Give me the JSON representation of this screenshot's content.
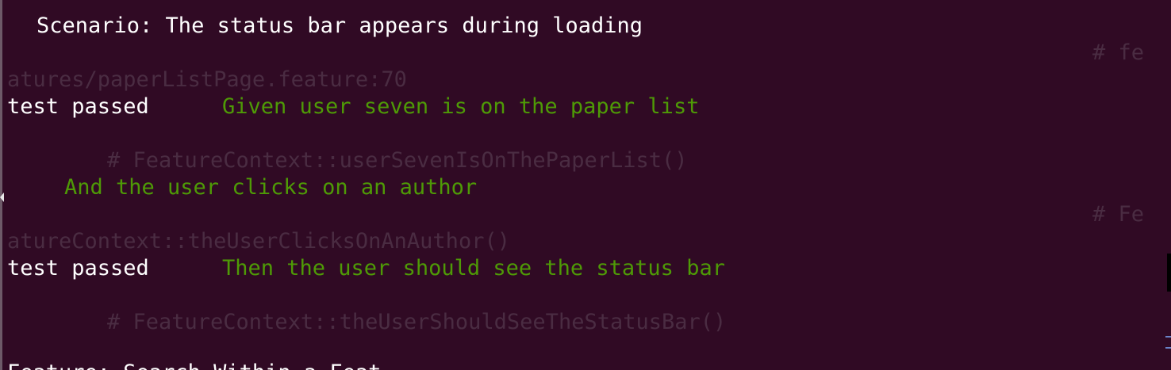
{
  "terminal": {
    "scenario": "Scenario: The status bar appears during loading",
    "comment_feature_part1": "# fe",
    "comment_feature_part2": "atures/paperListPage.feature:70",
    "step1_status": "test passed",
    "step1_text": "Given user seven is on the paper list",
    "step1_comment": "# FeatureContext::userSevenIsOnThePaperList()",
    "step2_text": "And the user clicks on an author",
    "step2_comment_part1": "# Fe",
    "step2_comment_part2": "atureContext::theUserClicksOnAnAuthor()",
    "step3_status": "test passed",
    "step3_text": "Then the user should see the status bar",
    "step3_comment": "# FeatureContext::theUserShouldSeeTheStatusBar()",
    "last_line_partial": "Feature: Search Within a Feat"
  },
  "colors": {
    "background": "#300a24",
    "text": "#ffffff",
    "passed_step": "#4e9a06",
    "comment": "#4a2c42"
  }
}
